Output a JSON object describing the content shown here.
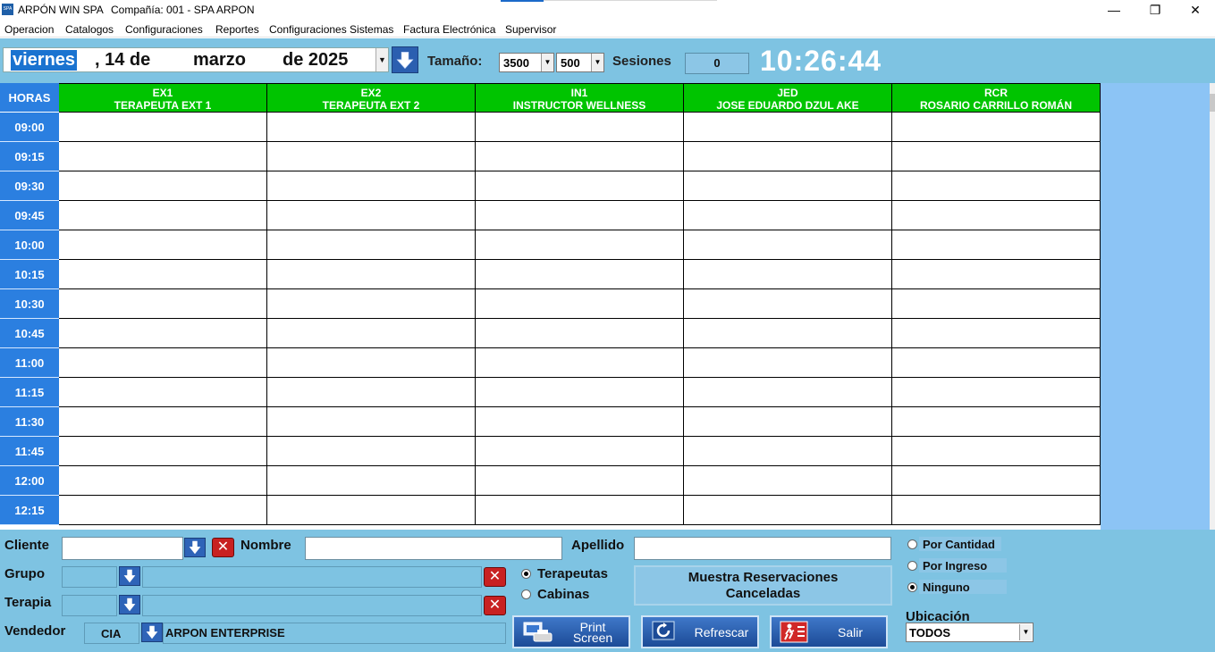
{
  "window": {
    "app_name": "ARPÓN WIN SPA",
    "company": "Compañía: 001 - SPA ARPON",
    "icon_text": "SPA",
    "controls": {
      "minimize": "—",
      "restore": "❐",
      "close": "✕"
    }
  },
  "menu": [
    "Operacion",
    "Catalogos",
    "Configuraciones",
    "Reportes",
    "Configuraciones Sistemas",
    "Factura Electrónica",
    "Supervisor"
  ],
  "header": {
    "weekday": "viernes",
    "day": ", 14 de",
    "month": "marzo",
    "year": "de 2025",
    "tamano_label": "Tamaño:",
    "tamano_1": "3500",
    "tamano_2": "500",
    "sesiones_label": "Sesiones",
    "sesiones_value": "0",
    "clock": "10:26:44"
  },
  "schedule": {
    "hours_header": "HORAS",
    "hours": [
      "09:00",
      "09:15",
      "09:30",
      "09:45",
      "10:00",
      "10:15",
      "10:30",
      "10:45",
      "11:00",
      "11:15",
      "11:30",
      "11:45",
      "12:00",
      "12:15"
    ],
    "columns": [
      {
        "code": "EX1",
        "name": "TERAPEUTA EXT 1"
      },
      {
        "code": "EX2",
        "name": "TERAPEUTA EXT 2"
      },
      {
        "code": "IN1",
        "name": "INSTRUCTOR WELLNESS"
      },
      {
        "code": "JED",
        "name": "JOSE EDUARDO DZUL AKE"
      },
      {
        "code": "RCR",
        "name": "ROSARIO CARRILLO ROMÁN"
      }
    ]
  },
  "filters": {
    "cliente_label": "Cliente",
    "cliente_value": "",
    "nombre_label": "Nombre",
    "nombre_value": "",
    "apellido_label": "Apellido",
    "apellido_value": "",
    "grupo_label": "Grupo",
    "terapia_label": "Terapia",
    "vendedor_label": "Vendedor",
    "vendedor_code": "CIA",
    "vendedor_name": "ARPON ENTERPRISE",
    "view_terapeutas": "Terapeutas",
    "view_cabinas": "Cabinas",
    "view_selected": "Terapeutas",
    "muestra_line1": "Muestra Reservaciones",
    "muestra_line2": "Canceladas",
    "sort_por_cantidad": "Por Cantidad",
    "sort_por_ingreso": "Por Ingreso",
    "sort_ninguno": "Ninguno",
    "sort_selected": "Ninguno",
    "ubicacion_label": "Ubicación",
    "ubicacion_value": "TODOS"
  },
  "actions": {
    "print_line1": "Print",
    "print_line2": "Screen",
    "refrescar": "Refrescar",
    "salir": "Salir"
  },
  "colors": {
    "panel_blue": "#7ec3e2",
    "hour_blue": "#2b7fe0",
    "header_green": "#00c400",
    "side_panel": "#8cc4f5"
  }
}
